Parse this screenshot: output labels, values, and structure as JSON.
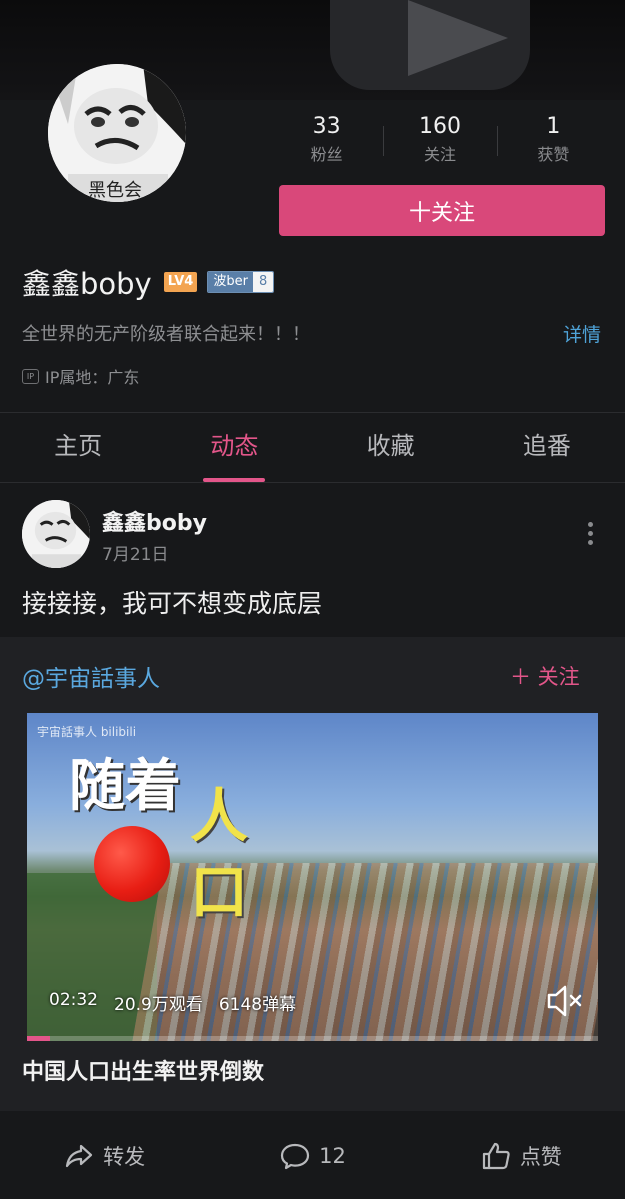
{
  "profile": {
    "name": "鑫鑫boby",
    "level": "LV4",
    "fan_badge": {
      "title": "波ber",
      "level": "8"
    },
    "stats": [
      {
        "value": "33",
        "label": "粉丝"
      },
      {
        "value": "160",
        "label": "关注"
      },
      {
        "value": "1",
        "label": "获赞"
      }
    ],
    "follow_label": "十关注",
    "bio": "全世界的无产阶级者联合起来！！！",
    "detail_label": "详情",
    "ip_badge": "IP",
    "ip_location": "IP属地：广东"
  },
  "tabs": [
    {
      "label": "主页",
      "active": false
    },
    {
      "label": "动态",
      "active": true
    },
    {
      "label": "收藏",
      "active": false
    },
    {
      "label": "追番",
      "active": false
    }
  ],
  "post": {
    "author": "鑫鑫boby",
    "date": "7月21日",
    "text": "接接接，我可不想变成底层",
    "repost": {
      "author": "@宇宙話事人",
      "follow_label": "＋ 关注",
      "video": {
        "watermark": "宇宙話事人 bilibili",
        "caption_1": "随着",
        "caption_2": "人口",
        "duration": "02:32",
        "views": "20.9万观看",
        "danmaku": "6148弹幕",
        "progress": 0.04
      },
      "title": "中国人口出生率世界倒数"
    }
  },
  "actions": {
    "share_label": "转发",
    "comment_count": "12",
    "like_label": "点赞"
  },
  "colors": {
    "accent": "#e3568a",
    "follow_button": "#d9487a",
    "link": "#4fa3d8",
    "background": "#17181a"
  }
}
